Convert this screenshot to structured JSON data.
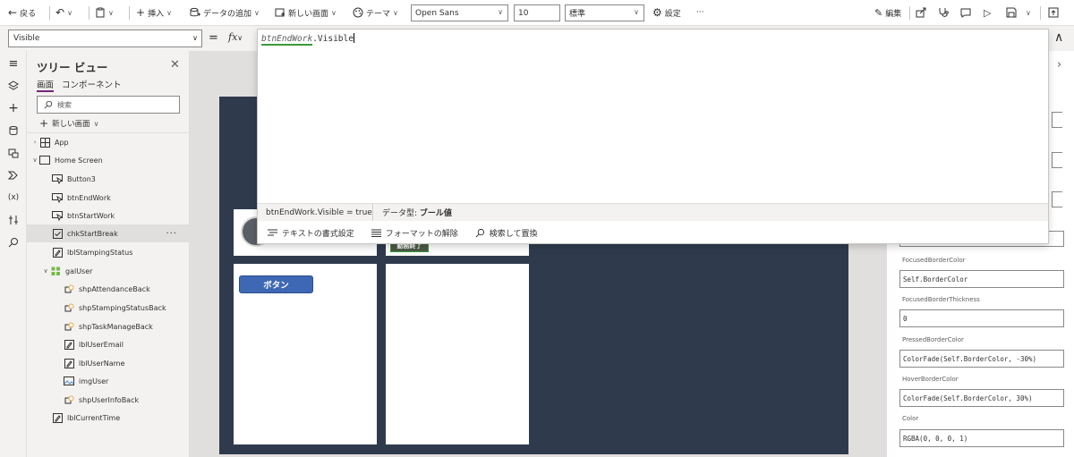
{
  "toolbar": {
    "back": "戻る",
    "insert": "挿入",
    "add_data": "データの追加",
    "new_screen": "新しい画面",
    "theme": "テーマ",
    "font": "Open Sans",
    "font_size": "10",
    "font_weight": "標準",
    "settings": "設定",
    "more": "···",
    "edit": "編集"
  },
  "formula": {
    "property": "Visible",
    "equals": "=",
    "fx": "fx",
    "control": "btnEndWork",
    "expression_rest": ".Visible",
    "result": "btnEndWork.Visible  =  true",
    "datatype_label": "データ型:",
    "datatype_value": "ブール値",
    "format_text": "テキストの書式設定",
    "remove_format": "フォーマットの解除",
    "find_replace": "検索して置換"
  },
  "tree": {
    "title": "ツリー ビュー",
    "tab_screens": "画面",
    "tab_components": "コンポーネント",
    "search_placeholder": "検索",
    "new_screen": "新しい画面",
    "nodes": [
      {
        "label": "App"
      },
      {
        "label": "Home Screen"
      },
      {
        "label": "Button3"
      },
      {
        "label": "btnEndWork"
      },
      {
        "label": "btnStartWork"
      },
      {
        "label": "chkStartBreak"
      },
      {
        "label": "lblStampingStatus"
      },
      {
        "label": "galUser"
      },
      {
        "label": "shpAttendanceBack"
      },
      {
        "label": "shpStampingStatusBack"
      },
      {
        "label": "shpTaskManageBack"
      },
      {
        "label": "lblUserEmail"
      },
      {
        "label": "lblUserName"
      },
      {
        "label": "imgUser"
      },
      {
        "label": "shpUserInfoBack"
      },
      {
        "label": "lblCurrentTime"
      }
    ],
    "selected_more": "···"
  },
  "canvas": {
    "button_label": "ボタン",
    "endwork_label": "勤務終了"
  },
  "properties": [
    {
      "label": "FocusedBorderColor",
      "value": "Self.BorderColor"
    },
    {
      "label": "FocusedBorderThickness",
      "value": "0"
    },
    {
      "label": "PressedBorderColor",
      "value": "ColorFade(Self.BorderColor, -30%)"
    },
    {
      "label": "HoverBorderColor",
      "value": "ColorFade(Self.BorderColor, 30%)"
    },
    {
      "label": "Color",
      "value": "RGBA(0, 0, 0, 1)"
    }
  ],
  "colors": {
    "accent": "#742774",
    "button_blue": "#3e68b4",
    "screen_bg": "#2f3b4d"
  }
}
